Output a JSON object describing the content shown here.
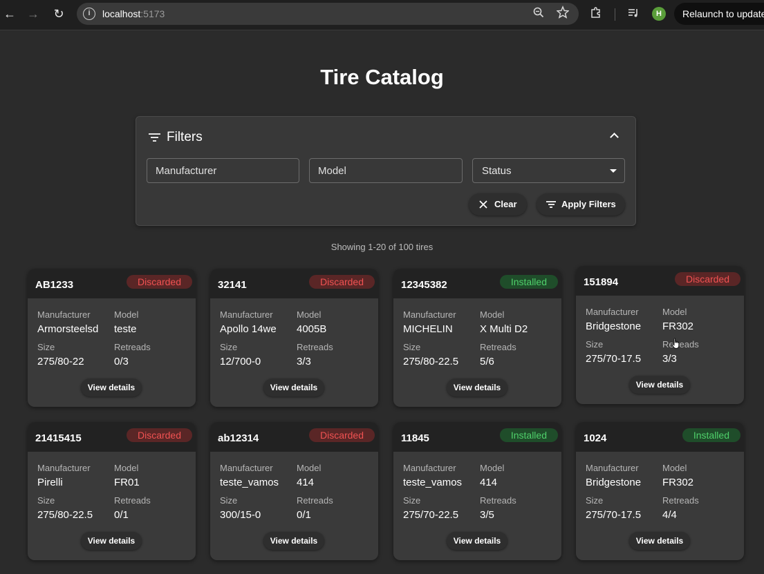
{
  "browser": {
    "back_label": "←",
    "forward_label": "→",
    "reload_label": "↻",
    "info_label": "i",
    "url_host": "localhost",
    "url_port": ":5173",
    "profile_initial": "H",
    "relaunch_label": "Relaunch to update"
  },
  "page": {
    "title": "Tire Catalog",
    "showing_text": "Showing 1-20 of 100 tires"
  },
  "filters": {
    "title": "Filters",
    "manufacturer_placeholder": "Manufacturer",
    "model_placeholder": "Model",
    "status_label": "Status",
    "clear_label": "Clear",
    "apply_label": "Apply Filters"
  },
  "colors": {
    "background": "#2b2b2b",
    "card": "#3a3a3a",
    "card_header": "#222222",
    "discarded_text": "#f05252",
    "discarded_bg": "#5a2626",
    "installed_text": "#4fd06b",
    "installed_bg": "#1f4d2a"
  },
  "labels": {
    "manufacturer": "Manufacturer",
    "model": "Model",
    "size": "Size",
    "retreads": "Retreads",
    "view_details": "View details"
  },
  "tires": [
    {
      "code": "AB1233",
      "status": "Discarded",
      "manufacturer": "Armorsteelsd",
      "model": "teste",
      "size": "275/80-22",
      "retreads": "0/3"
    },
    {
      "code": "32141",
      "status": "Discarded",
      "manufacturer": "Apollo 14we",
      "model": "4005B",
      "size": "12/700-0",
      "retreads": "3/3"
    },
    {
      "code": "12345382",
      "status": "Installed",
      "manufacturer": "MICHELIN",
      "model": "X Multi D2",
      "size": "275/80-22.5",
      "retreads": "5/6"
    },
    {
      "code": "151894",
      "status": "Discarded",
      "manufacturer": "Bridgestone",
      "model": "FR302",
      "size": "275/70-17.5",
      "retreads": "3/3"
    },
    {
      "code": "21415415",
      "status": "Discarded",
      "manufacturer": "Pirelli",
      "model": "FR01",
      "size": "275/80-22.5",
      "retreads": "0/1"
    },
    {
      "code": "ab12314",
      "status": "Discarded",
      "manufacturer": "teste_vamos",
      "model": "414",
      "size": "300/15-0",
      "retreads": "0/1"
    },
    {
      "code": "11845",
      "status": "Installed",
      "manufacturer": "teste_vamos",
      "model": "414",
      "size": "275/70-22.5",
      "retreads": "3/5"
    },
    {
      "code": "1024",
      "status": "Installed",
      "manufacturer": "Bridgestone",
      "model": "FR302",
      "size": "275/70-17.5",
      "retreads": "4/4"
    }
  ]
}
